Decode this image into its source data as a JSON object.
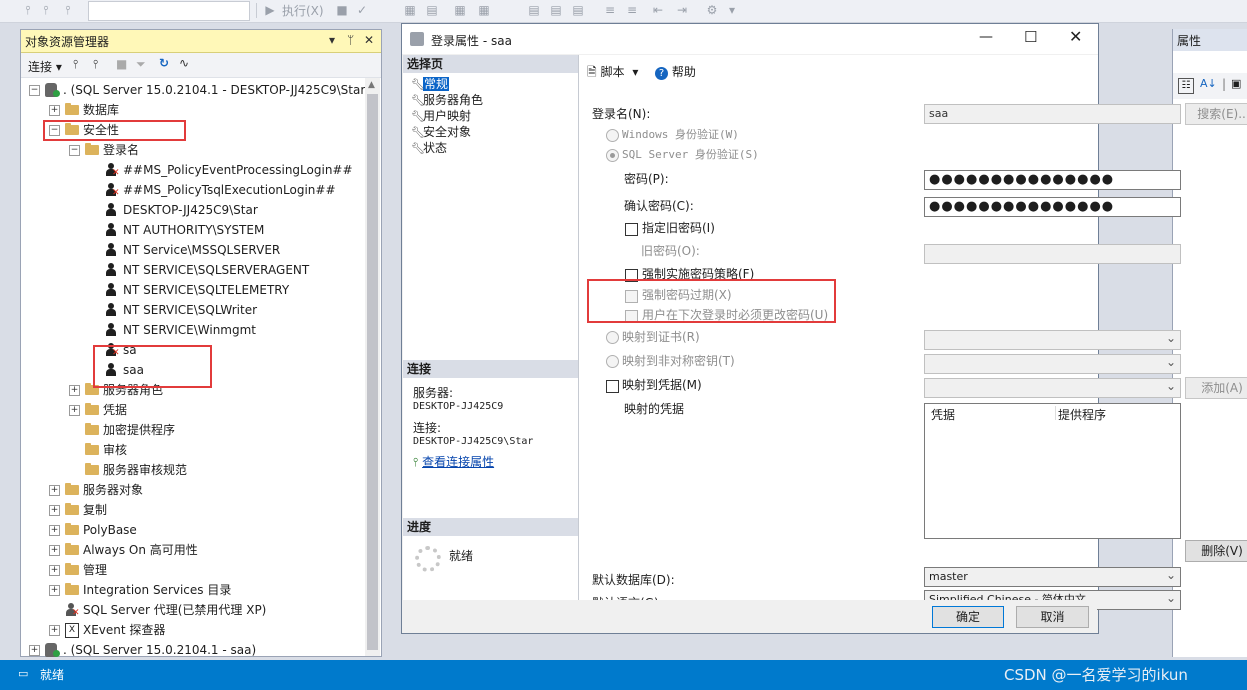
{
  "toolbar": {
    "execute_label": "执行(X)"
  },
  "object_explorer": {
    "title": "对象资源管理器",
    "pin_glyph": "▾ ᛘ",
    "close_glyph": "✕",
    "connect_label": "连接",
    "tree": [
      {
        "label": ". (SQL Server 15.0.2104.1 - DESKTOP-JJ425C9\\Star)",
        "icon": "server-icon",
        "expander": "−"
      },
      {
        "label": "数据库",
        "icon": "folder-icon",
        "expander": "+"
      },
      {
        "label": "安全性",
        "icon": "folder-icon",
        "expander": "−"
      },
      {
        "label": "登录名",
        "icon": "folder-icon",
        "expander": "−"
      },
      {
        "label": "##MS_PolicyEventProcessingLogin##",
        "icon": "login-disabled-icon"
      },
      {
        "label": "##MS_PolicyTsqlExecutionLogin##",
        "icon": "login-disabled-icon"
      },
      {
        "label": "DESKTOP-JJ425C9\\Star",
        "icon": "login-icon"
      },
      {
        "label": "NT AUTHORITY\\SYSTEM",
        "icon": "login-icon"
      },
      {
        "label": "NT Service\\MSSQLSERVER",
        "icon": "login-icon"
      },
      {
        "label": "NT SERVICE\\SQLSERVERAGENT",
        "icon": "login-icon"
      },
      {
        "label": "NT SERVICE\\SQLTELEMETRY",
        "icon": "login-icon"
      },
      {
        "label": "NT SERVICE\\SQLWriter",
        "icon": "login-icon"
      },
      {
        "label": "NT SERVICE\\Winmgmt",
        "icon": "login-icon"
      },
      {
        "label": "sa",
        "icon": "login-disabled-icon"
      },
      {
        "label": "saa",
        "icon": "login-icon"
      },
      {
        "label": "服务器角色",
        "icon": "folder-icon",
        "expander": "+"
      },
      {
        "label": "凭据",
        "icon": "folder-icon",
        "expander": "+"
      },
      {
        "label": "加密提供程序",
        "icon": "folder-icon"
      },
      {
        "label": "审核",
        "icon": "folder-icon"
      },
      {
        "label": "服务器审核规范",
        "icon": "folder-icon"
      },
      {
        "label": "服务器对象",
        "icon": "folder-icon",
        "expander": "+"
      },
      {
        "label": "复制",
        "icon": "folder-icon",
        "expander": "+"
      },
      {
        "label": "PolyBase",
        "icon": "folder-icon",
        "expander": "+"
      },
      {
        "label": "Always On 高可用性",
        "icon": "folder-icon",
        "expander": "+"
      },
      {
        "label": "管理",
        "icon": "folder-icon",
        "expander": "+"
      },
      {
        "label": "Integration Services 目录",
        "icon": "folder-icon",
        "expander": "+"
      },
      {
        "label": "SQL Server 代理(已禁用代理 XP)",
        "icon": "agent-icon"
      },
      {
        "label": "XEvent 探查器",
        "icon": "xevent-icon",
        "expander": "+"
      },
      {
        "label": ". (SQL Server 15.0.2104.1 - saa)",
        "icon": "server-icon",
        "expander": "+"
      }
    ]
  },
  "properties_pane": {
    "title": "属性"
  },
  "dialog": {
    "title": "登录属性 - saa",
    "select_page_header": "选择页",
    "pages": [
      "常规",
      "服务器角色",
      "用户映射",
      "安全对象",
      "状态"
    ],
    "connection_header": "连接",
    "server_label": "服务器:",
    "server_value": "DESKTOP-JJ425C9",
    "connection_label": "连接:",
    "connection_value": "DESKTOP-JJ425C9\\Star",
    "view_connection_link": "查看连接属性",
    "progress_header": "进度",
    "progress_status": "就绪",
    "script_label": "脚本",
    "help_label": "帮助",
    "login_name_label": "登录名(N):",
    "login_name_value": "saa",
    "search_button": "搜索(E)...",
    "windows_auth_label": "Windows 身份验证(W)",
    "sql_auth_label": "SQL Server 身份验证(S)",
    "password_label": "密码(P):",
    "password_value": "●●●●●●●●●●●●●●●",
    "confirm_password_label": "确认密码(C):",
    "confirm_password_value": "●●●●●●●●●●●●●●●",
    "specify_old_password_label": "指定旧密码(I)",
    "old_password_label": "旧密码(O):",
    "enforce_policy_label": "强制实施密码策略(F)",
    "enforce_expiration_label": "强制密码过期(X)",
    "must_change_label": "用户在下次登录时必须更改密码(U)",
    "map_certificate_label": "映射到证书(R)",
    "map_asym_key_label": "映射到非对称密钥(T)",
    "map_credential_label": "映射到凭据(M)",
    "add_button": "添加(A)",
    "mapped_credentials_label": "映射的凭据",
    "cred_col_credential": "凭据",
    "cred_col_provider": "提供程序",
    "remove_button": "删除(V)",
    "default_db_label": "默认数据库(D):",
    "default_db_value": "master",
    "default_lang_label": "默认语言(G):",
    "default_lang_value": "Simplified Chinese - 简体中文",
    "ok_button": "确定",
    "cancel_button": "取消"
  },
  "statusbar": {
    "text": "就绪",
    "watermark": "CSDN @一名爱学习的ikun"
  },
  "colors": {
    "accent": "#007acc",
    "highlight": "#e23b3b",
    "panel_title": "#fff8b8"
  }
}
